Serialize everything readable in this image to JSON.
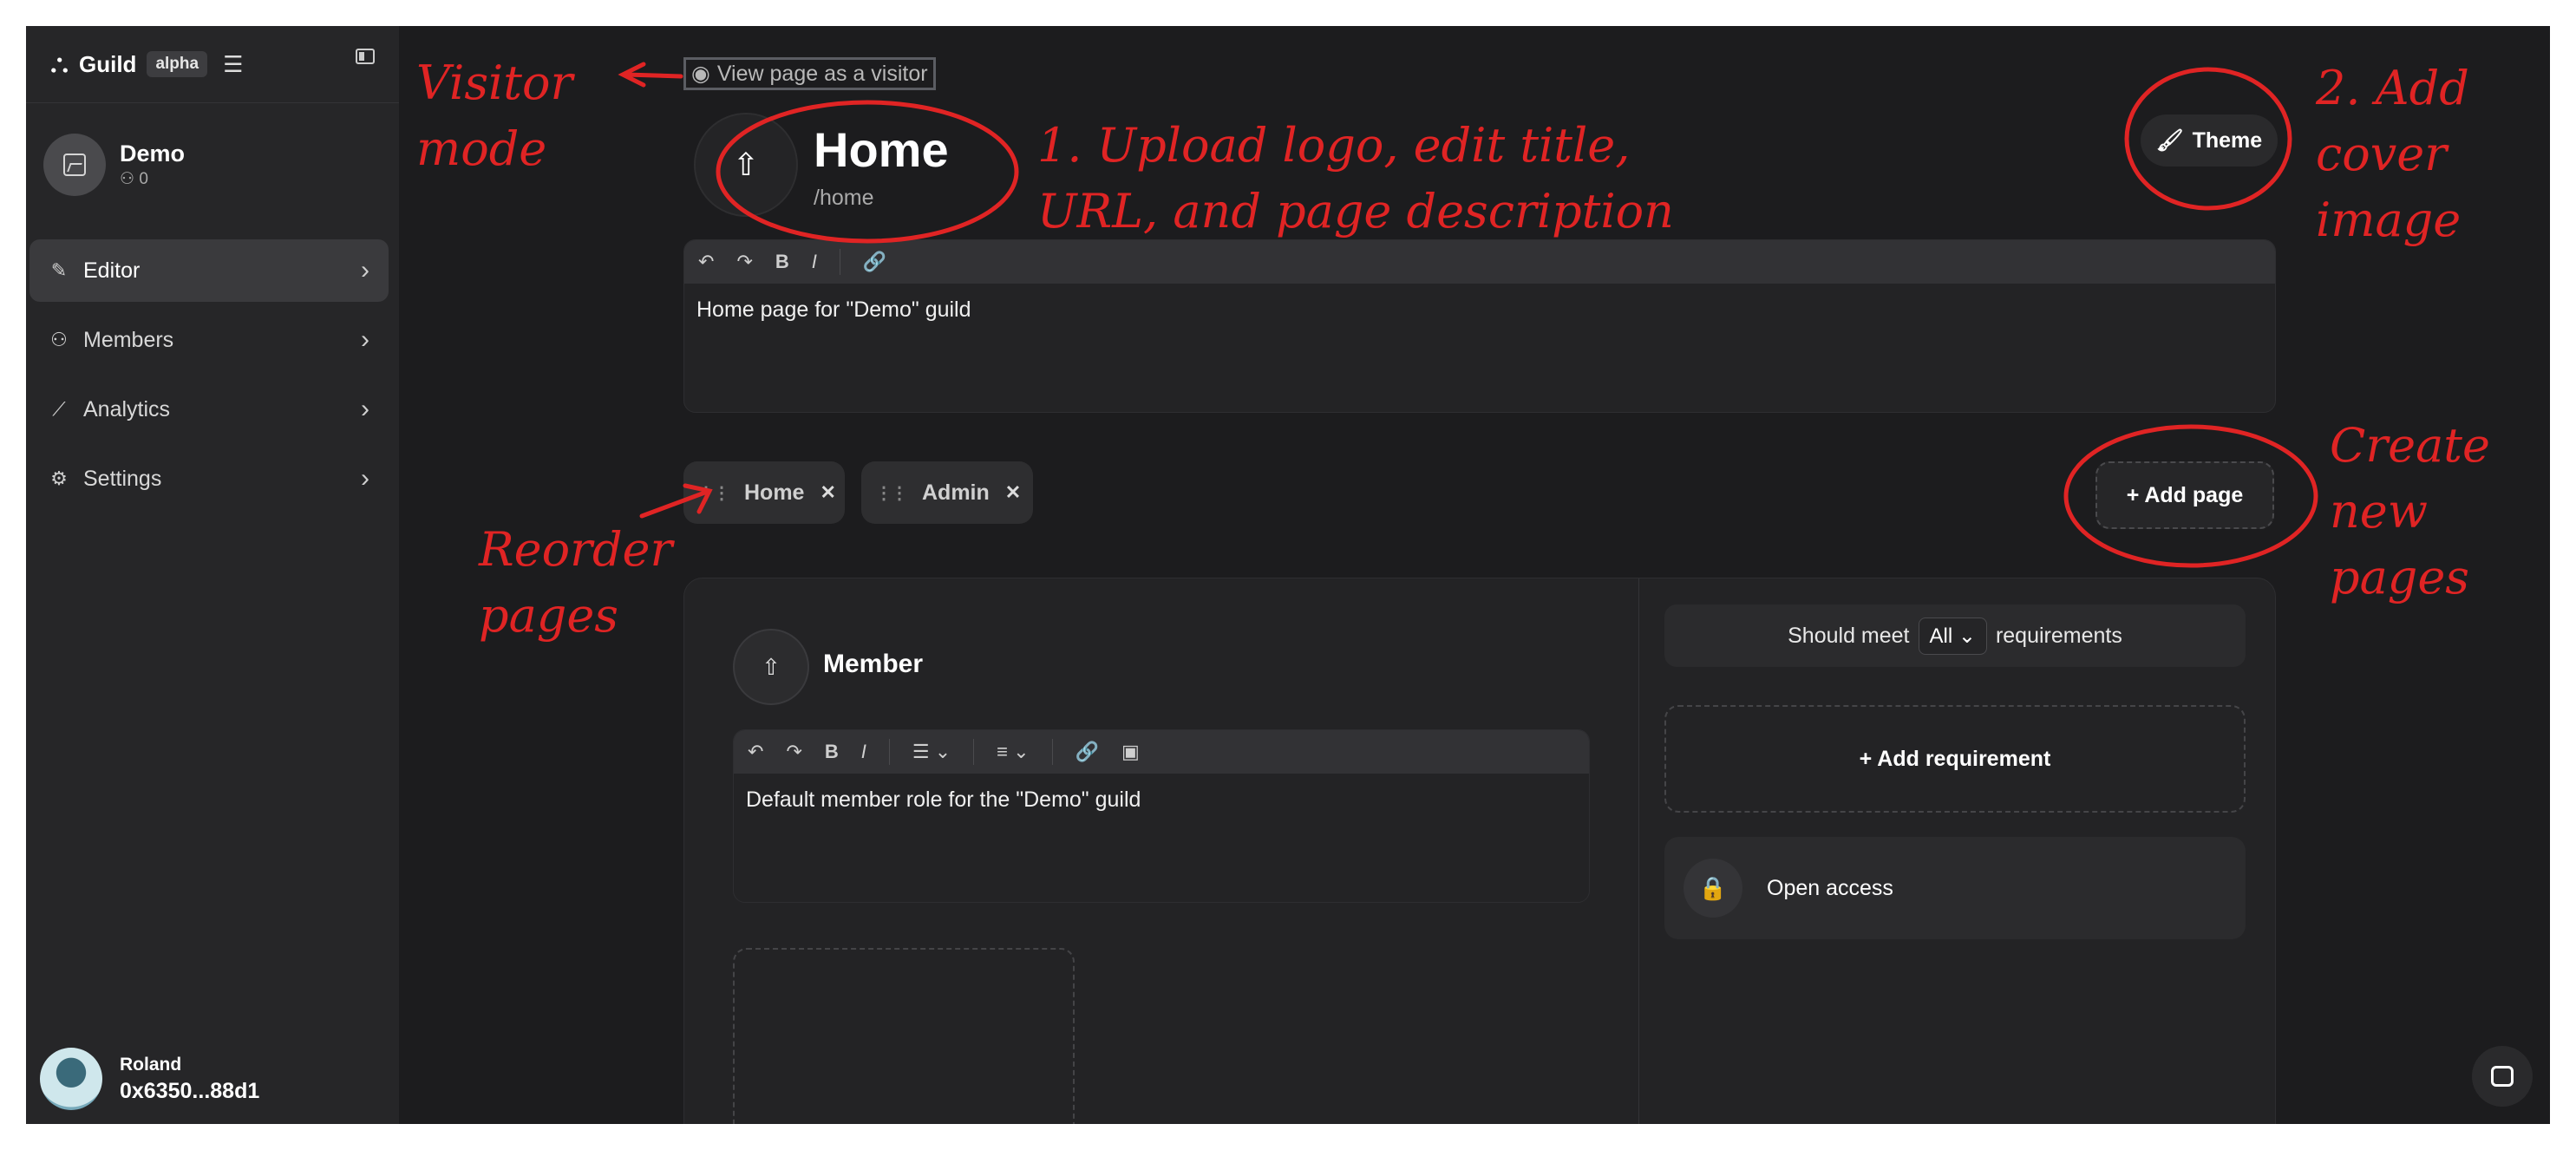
{
  "sidebar": {
    "brand": "Guild",
    "badge": "alpha",
    "guild": {
      "name": "Demo",
      "members": "0"
    },
    "items": [
      {
        "label": "Editor"
      },
      {
        "label": "Members"
      },
      {
        "label": "Analytics"
      },
      {
        "label": "Settings"
      }
    ],
    "user": {
      "name": "Roland",
      "address": "0x6350...88d1"
    }
  },
  "main": {
    "visitor_label": "View page as a visitor",
    "page": {
      "title": "Home",
      "url": "/home",
      "description": "Home page for \"Demo\" guild"
    },
    "theme_label": "Theme",
    "tabs": [
      {
        "label": "Home"
      },
      {
        "label": "Admin"
      }
    ],
    "add_page_label": "+ Add page",
    "role": {
      "name": "Member",
      "description": "Default member role for the \"Demo\" guild",
      "should_meet_prefix": "Should meet",
      "should_meet_value": "All",
      "should_meet_suffix": "requirements",
      "add_requirement_label": "+ Add requirement",
      "open_access_label": "Open access"
    }
  },
  "annotations": {
    "visitor": [
      "Visitor",
      "mode"
    ],
    "upload": [
      "1. Upload logo, edit title,",
      "URL, and page description"
    ],
    "theme": [
      "2. Add",
      "cover",
      "image"
    ],
    "create": [
      "Create",
      "new",
      "pages"
    ],
    "reorder": [
      "Reorder",
      "pages"
    ]
  },
  "colors": {
    "annotation": "#e02424",
    "background": "#1c1c1e",
    "sidebar": "#262628"
  }
}
